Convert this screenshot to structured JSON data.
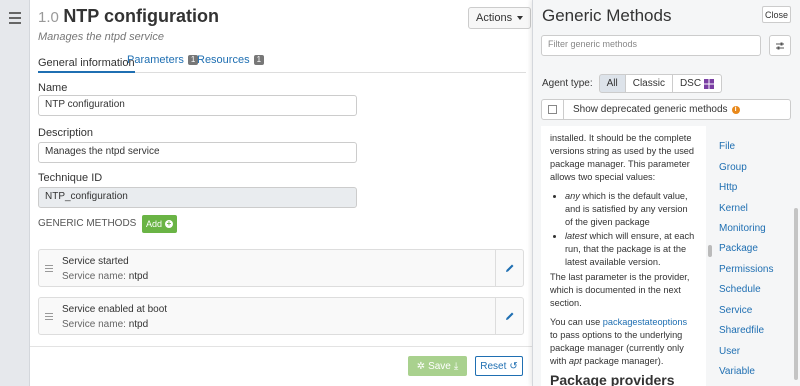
{
  "technique": {
    "version": "1.0",
    "title": "NTP configuration",
    "subtitle": "Manages the ntpd service",
    "actions_label": "Actions"
  },
  "tabs": [
    {
      "label": "General information",
      "badge": ""
    },
    {
      "label": "Parameters",
      "badge": "1"
    },
    {
      "label": "Resources",
      "badge": "1"
    }
  ],
  "fields": {
    "name_label": "Name",
    "name_value": "NTP configuration",
    "description_label": "Description",
    "description_value": "Manages the ntpd service",
    "technique_id_label": "Technique ID",
    "technique_id_value": "NTP_configuration"
  },
  "generic_methods_section": {
    "label": "GENERIC METHODS",
    "count": "2",
    "add_label": "Add"
  },
  "methods": [
    {
      "name": "Service started",
      "param_label": "Service name:",
      "param_value": "ntpd"
    },
    {
      "name": "Service enabled at boot",
      "param_label": "Service name:",
      "param_value": "ntpd"
    }
  ],
  "footer": {
    "save_label": "Save",
    "reset_label": "Reset"
  },
  "panel": {
    "title": "Generic Methods",
    "close_label": "Close",
    "filter_placeholder": "Filter generic methods",
    "agent_type_label": "Agent type:",
    "agent_options": [
      "All",
      "Classic",
      "DSC"
    ],
    "deprecated_label": "Show deprecated generic methods"
  },
  "doc": {
    "p1": "installed. It should be the complete versions string as used by the used package manager. This parameter allows two special values:",
    "li1_em": "any",
    "li1_rest": " which is the default value, and is satisfied by any version of the given package",
    "li2_em": "latest",
    "li2_rest": " which will ensure, at each run, that the package is at the latest available version.",
    "p2": "The last parameter is the provider, which is documented in the next section.",
    "p3_pre": "You can use ",
    "p3_link": "packagestateoptions",
    "p3_mid": " to pass options to the underlying package manager (currently only with ",
    "p3_em": "apt",
    "p3_post": " package manager).",
    "heading": "Package providers"
  },
  "categories": [
    "File",
    "Group",
    "Http",
    "Kernel",
    "Monitoring",
    "Package",
    "Permissions",
    "Schedule",
    "Service",
    "Sharedfile",
    "User",
    "Variable"
  ],
  "colors": {
    "accent": "#1f6fb2",
    "add_green": "#6ab445",
    "save_green": "#a9d18e",
    "info_orange": "#e8891c"
  }
}
